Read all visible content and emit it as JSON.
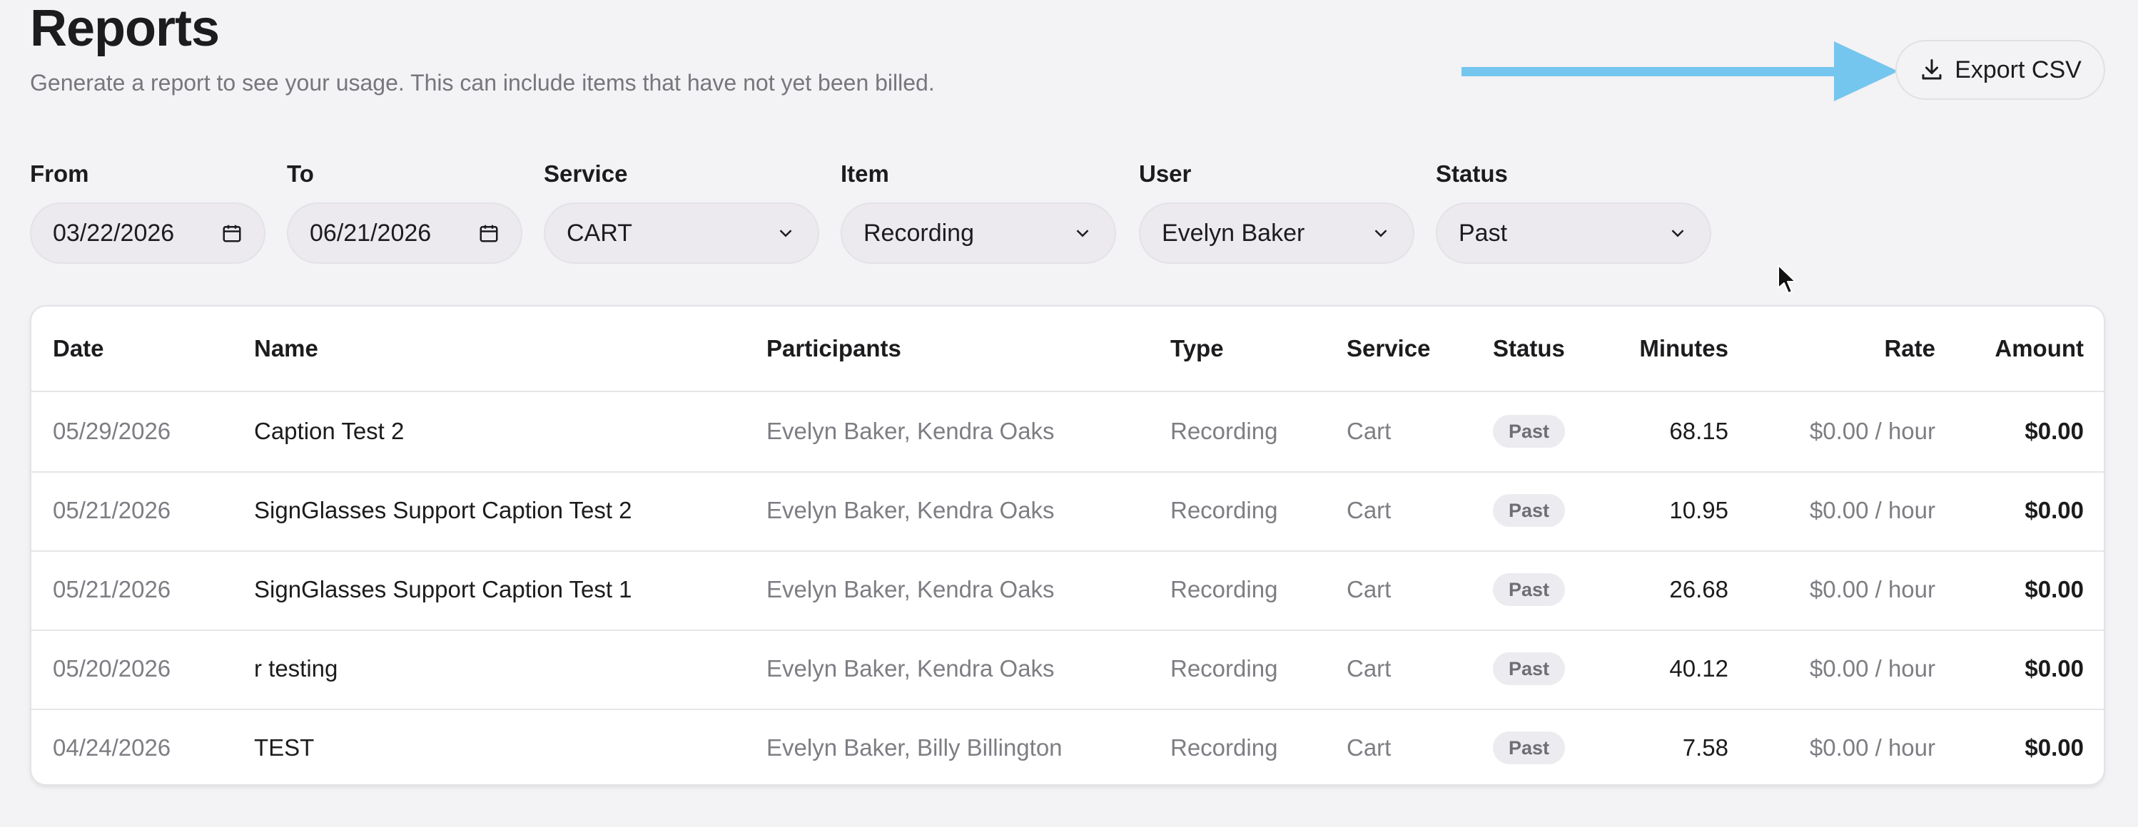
{
  "header": {
    "title": "Reports",
    "subtitle": "Generate a report to see your usage. This can include items that have not yet been billed.",
    "export_label": "Export CSV"
  },
  "filters": {
    "from": {
      "label": "From",
      "value": "03/22/2026"
    },
    "to": {
      "label": "To",
      "value": "06/21/2026"
    },
    "service": {
      "label": "Service",
      "value": "CART"
    },
    "item": {
      "label": "Item",
      "value": "Recording"
    },
    "user": {
      "label": "User",
      "value": "Evelyn Baker"
    },
    "status": {
      "label": "Status",
      "value": "Past"
    }
  },
  "table": {
    "headers": {
      "date": "Date",
      "name": "Name",
      "participants": "Participants",
      "type": "Type",
      "service": "Service",
      "status": "Status",
      "minutes": "Minutes",
      "rate": "Rate",
      "amount": "Amount"
    },
    "rows": [
      {
        "date": "05/29/2026",
        "name": "Caption Test 2",
        "participants": "Evelyn Baker, Kendra Oaks",
        "type": "Recording",
        "service": "Cart",
        "status": "Past",
        "minutes": "68.15",
        "rate": "$0.00 / hour",
        "amount": "$0.00"
      },
      {
        "date": "05/21/2026",
        "name": "SignGlasses Support Caption Test 2",
        "participants": "Evelyn Baker, Kendra Oaks",
        "type": "Recording",
        "service": "Cart",
        "status": "Past",
        "minutes": "10.95",
        "rate": "$0.00 / hour",
        "amount": "$0.00"
      },
      {
        "date": "05/21/2026",
        "name": "SignGlasses Support Caption Test 1",
        "participants": "Evelyn Baker, Kendra Oaks",
        "type": "Recording",
        "service": "Cart",
        "status": "Past",
        "minutes": "26.68",
        "rate": "$0.00 / hour",
        "amount": "$0.00"
      },
      {
        "date": "05/20/2026",
        "name": "r testing",
        "participants": "Evelyn Baker, Kendra Oaks",
        "type": "Recording",
        "service": "Cart",
        "status": "Past",
        "minutes": "40.12",
        "rate": "$0.00 / hour",
        "amount": "$0.00"
      },
      {
        "date": "04/24/2026",
        "name": "TEST",
        "participants": "Evelyn Baker, Billy Billington",
        "type": "Recording",
        "service": "Cart",
        "status": "Past",
        "minutes": "7.58",
        "rate": "$0.00 / hour",
        "amount": "$0.00"
      }
    ]
  },
  "icons": {
    "export": "download-icon",
    "calendar": "calendar-icon",
    "dropdown": "chevron-down-icon",
    "annotation": "arrow-right-icon",
    "pointer": "mouse-cursor-icon"
  },
  "colors": {
    "background": "#f3f2f5",
    "annotation_arrow": "#74c6ef",
    "muted_text": "#7e7d83",
    "badge_bg": "#ecebef"
  }
}
